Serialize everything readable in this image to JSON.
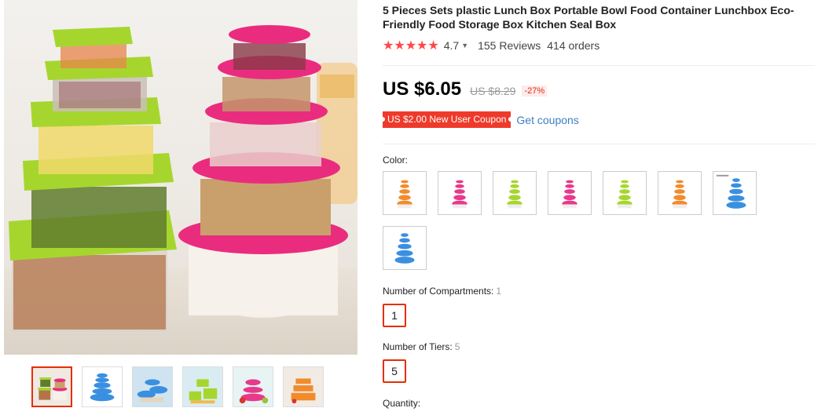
{
  "product": {
    "title": "5 Pieces Sets plastic Lunch Box Portable Bowl Food Container Lunchbox Eco-Friendly Food Storage Box Kitchen Seal Box",
    "rating": "4.7",
    "stars": "★★★★★",
    "reviews": "155 Reviews",
    "orders": "414 orders"
  },
  "price": {
    "current": "US $6.05",
    "original": "US $8.29",
    "discount": "-27%"
  },
  "coupon": {
    "label": "US $2.00 New User Coupon",
    "link": "Get coupons"
  },
  "color": {
    "label": "Color:",
    "swatches": [
      {
        "name": "orange",
        "lid": "#f28b2c"
      },
      {
        "name": "pink",
        "lid": "#e8398a"
      },
      {
        "name": "green",
        "lid": "#a6d62e"
      },
      {
        "name": "pink-2",
        "lid": "#e8398a"
      },
      {
        "name": "green-2",
        "lid": "#a6d62e"
      },
      {
        "name": "orange-2",
        "lid": "#f28b2c"
      },
      {
        "name": "blue-labeled",
        "lid": "#3a8fe0"
      },
      {
        "name": "blue",
        "lid": "#3a8fe0"
      }
    ]
  },
  "compartments": {
    "label": "Number of Compartments:",
    "selected": "1",
    "option": "1"
  },
  "tiers": {
    "label": "Number of Tiers:",
    "selected": "5",
    "option": "5"
  },
  "quantity": {
    "label": "Quantity:"
  },
  "colors": {
    "accent": "#e62e04",
    "star": "#ff4747",
    "link": "#3c80c6",
    "coupon_bg": "#ee3a2b"
  }
}
